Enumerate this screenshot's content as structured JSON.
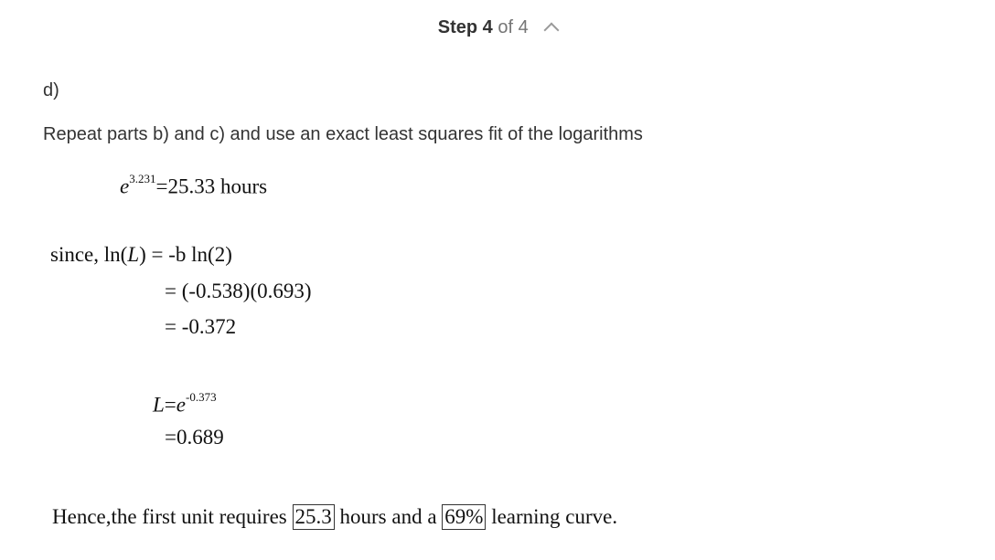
{
  "header": {
    "step_word": "Step",
    "step_number": "4",
    "of_total": "of 4",
    "toggle_icon": "chevron-up-icon"
  },
  "solution": {
    "part_label": "d)",
    "instruction": "Repeat parts b) and c) and use an exact least squares fit of the logarithms",
    "eq1": {
      "base": "e",
      "exponent": "3.231",
      "result": "=25.33 hours"
    },
    "since": {
      "prefix": "since, ln(",
      "var": "L",
      "suffix": ") = -b ln(2)",
      "line2": "= (-0.538)(0.693)",
      "line3": "= -0.372"
    },
    "eq2": {
      "lhs_var": "L",
      "equals": "=",
      "base": "e",
      "exponent": "-0.373",
      "line2": "=0.689"
    },
    "conclusion": {
      "part1": "Hence,the first unit requires ",
      "box1": "25.3",
      "part2": " hours and a ",
      "box2": "69%",
      "part3": " learning curve."
    }
  }
}
